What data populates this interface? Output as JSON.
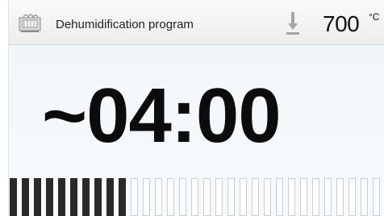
{
  "header": {
    "program_icon": "furnace-program-icon",
    "program_name": "Dehumidification program",
    "temperature_icon": "temperature-lower-icon",
    "temperature": "700",
    "temperature_unit": "°C"
  },
  "timer": {
    "remaining": "~04:00"
  },
  "progress": {
    "filled_segments": 10,
    "total_segments": 31,
    "fill_color": "#2a2a2a",
    "empty_color": "#ffffff"
  }
}
